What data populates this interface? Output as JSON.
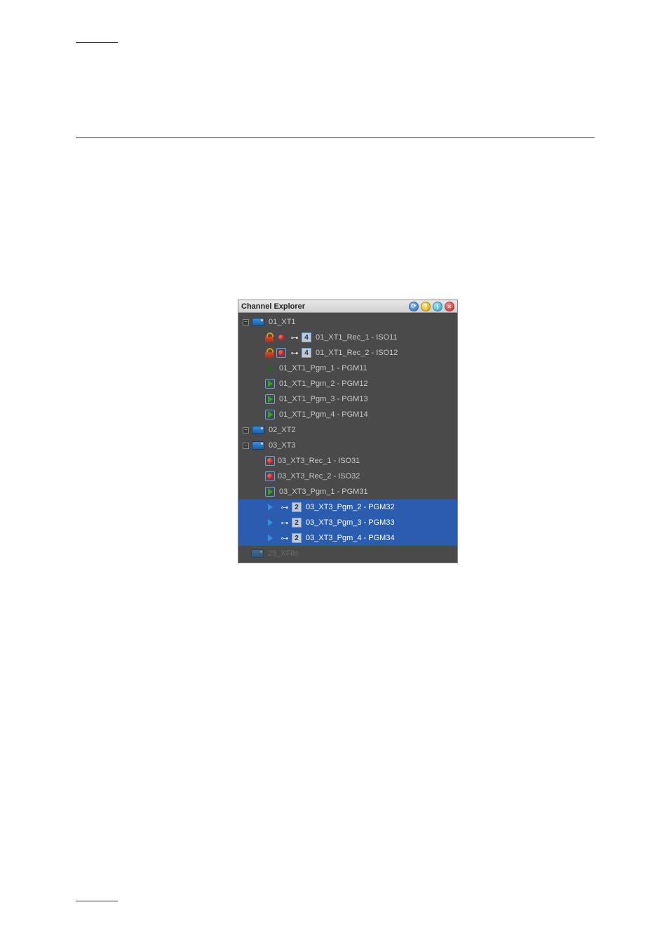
{
  "panel": {
    "title": "Channel Explorer"
  },
  "servers": [
    {
      "name": "01_XT1",
      "expanded": true,
      "channels": [
        {
          "label": "01_XT1_Rec_1 - ISO11",
          "type": "rec",
          "locked": true,
          "boxed": false,
          "linked": true,
          "badge": "4"
        },
        {
          "label": "01_XT1_Rec_2 - ISO12",
          "type": "rec",
          "locked": true,
          "boxed": true,
          "linked": true,
          "badge": "4"
        },
        {
          "label": "01_XT1_Pgm_1 - PGM11",
          "type": "pgm",
          "boxed": false
        },
        {
          "label": "01_XT1_Pgm_2 - PGM12",
          "type": "pgm",
          "boxed": true
        },
        {
          "label": "01_XT1_Pgm_3 - PGM13",
          "type": "pgm",
          "boxed": true
        },
        {
          "label": "01_XT1_Pgm_4 - PGM14",
          "type": "pgm",
          "boxed": true
        }
      ]
    },
    {
      "name": "02_XT2",
      "expanded": false,
      "channels": []
    },
    {
      "name": "03_XT3",
      "expanded": true,
      "channels": [
        {
          "label": "03_XT3_Rec_1 - ISO31",
          "type": "rec",
          "locked": false,
          "boxed": true
        },
        {
          "label": "03_XT3_Rec_2 - ISO32",
          "type": "rec",
          "locked": false,
          "boxed": true
        },
        {
          "label": "03_XT3_Pgm_1 - PGM31",
          "type": "pgm",
          "boxed": true
        },
        {
          "label": "03_XT3_Pgm_2 - PGM32",
          "type": "pgm",
          "boxed": false,
          "selected": true,
          "linked": true,
          "badge": "2",
          "blueplay": true
        },
        {
          "label": "03_XT3_Pgm_3 - PGM33",
          "type": "pgm",
          "boxed": false,
          "selected": true,
          "linked": true,
          "badge": "2",
          "blueplay": true
        },
        {
          "label": "03_XT3_Pgm_4 - PGM34",
          "type": "pgm",
          "boxed": false,
          "selected": true,
          "linked": true,
          "badge": "2",
          "blueplay": true
        }
      ]
    }
  ],
  "extra": {
    "name": "29_XFile"
  }
}
